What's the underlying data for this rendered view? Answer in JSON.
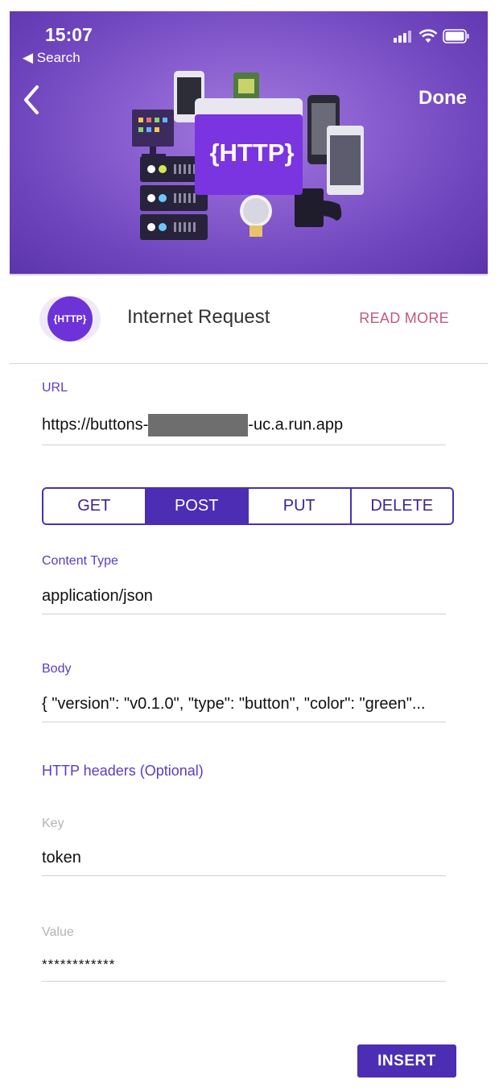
{
  "status_bar": {
    "time": "15:07",
    "back_label": "◀ Search"
  },
  "header": {
    "done_label": "Done",
    "hero_badge": "{HTTP}"
  },
  "app": {
    "icon_text": "{HTTP}",
    "title": "Internet Request",
    "read_more": "READ MORE"
  },
  "url": {
    "label": "URL",
    "value_prefix": "https://buttons-",
    "value_suffix": "-uc.a.run.app"
  },
  "methods": {
    "items": [
      "GET",
      "POST",
      "PUT",
      "DELETE"
    ],
    "selected": "POST"
  },
  "content_type": {
    "label": "Content Type",
    "value": "application/json"
  },
  "body": {
    "label": "Body",
    "value": "{ \"version\": \"v0.1.0\", \"type\": \"button\", \"color\": \"green\"..."
  },
  "headers": {
    "section_label": "HTTP headers (Optional)",
    "key_label": "Key",
    "key_value": "token",
    "value_label": "Value",
    "value_value": "************"
  },
  "footer": {
    "insert_label": "INSERT"
  },
  "colors": {
    "accent": "#4b2eb3",
    "link": "#c05a7d",
    "hero": "#8a5fd0"
  }
}
